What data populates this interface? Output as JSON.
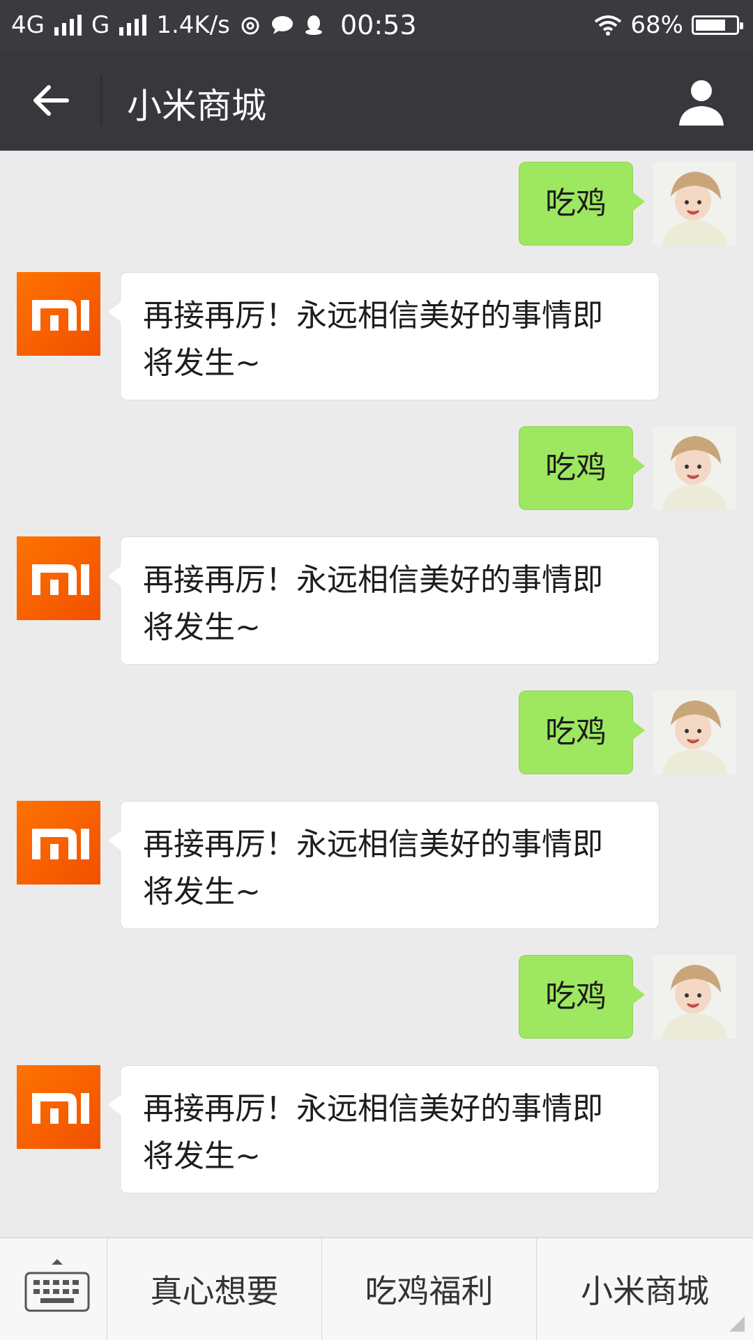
{
  "status_bar": {
    "net1": "4G",
    "net2": "G",
    "speed": "1.4K/s",
    "time": "00:53",
    "battery": "68%",
    "battery_level": 0.68,
    "icons": [
      "signal-icon",
      "netease-icon",
      "chat-bubble-icon",
      "qq-icon",
      "wifi-icon",
      "battery-icon"
    ]
  },
  "header": {
    "title": "小米商城",
    "icons": [
      "back-arrow-icon",
      "person-icon"
    ]
  },
  "messages": [
    {
      "from": "me",
      "text": "吃鸡"
    },
    {
      "from": "mi",
      "lines": [
        "再接再厉！永远相信美好的事情即",
        "将发生~"
      ]
    },
    {
      "from": "me",
      "text": "吃鸡"
    },
    {
      "from": "mi",
      "lines": [
        "再接再厉！永远相信美好的事情即",
        "将发生~"
      ]
    },
    {
      "from": "me",
      "text": "吃鸡"
    },
    {
      "from": "mi",
      "lines": [
        "再接再厉！永远相信美好的事情即",
        "将发生~"
      ]
    },
    {
      "from": "me",
      "text": "吃鸡"
    },
    {
      "from": "mi",
      "lines": [
        "再接再厉！永远相信美好的事情即",
        "将发生~"
      ]
    }
  ],
  "bottom_menu": {
    "keyboard_icon": "keyboard-icon",
    "items": [
      "真心想要",
      "吃鸡福利",
      "小米商城"
    ]
  },
  "colors": {
    "status_bar": "#3a3a3f",
    "nav_bar": "#37373c",
    "chat_bg": "#ebebeb",
    "outgoing_bubble": "#9ee761",
    "mi_orange": "#ff6700"
  }
}
